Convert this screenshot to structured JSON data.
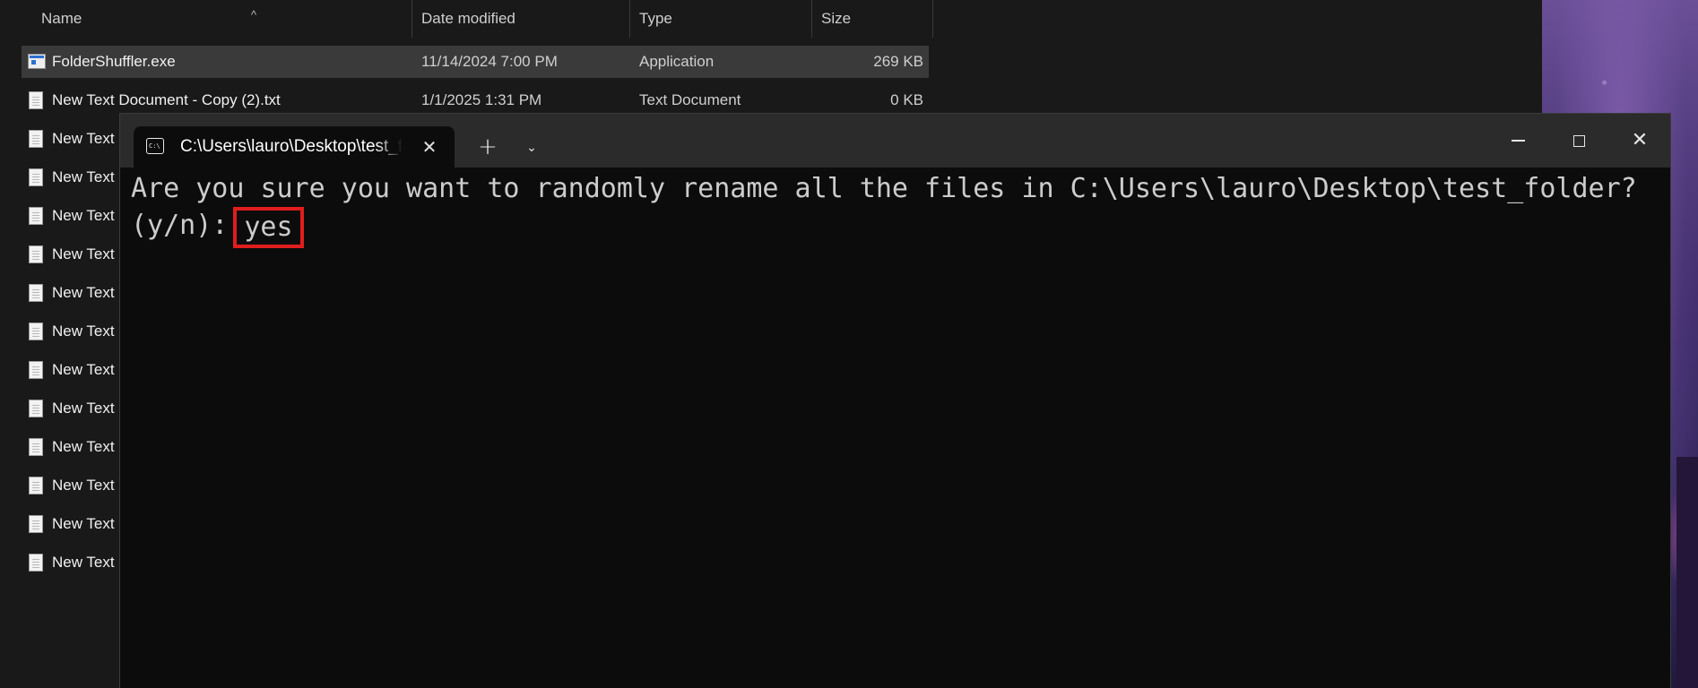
{
  "explorer": {
    "columns": {
      "name": "Name",
      "date_modified": "Date modified",
      "type": "Type",
      "size": "Size"
    },
    "files": [
      {
        "name": "FolderShuffler.exe",
        "date": "11/14/2024 7:00 PM",
        "type": "Application",
        "size": "269 KB",
        "icon": "exe-icon",
        "selected": true
      },
      {
        "name": "New Text Document - Copy (2).txt",
        "date": "1/1/2025 1:31 PM",
        "type": "Text Document",
        "size": "0 KB",
        "icon": "text-file-icon"
      },
      {
        "name": "New Text",
        "icon": "text-file-icon"
      },
      {
        "name": "New Text",
        "icon": "text-file-icon"
      },
      {
        "name": "New Text",
        "icon": "text-file-icon"
      },
      {
        "name": "New Text",
        "icon": "text-file-icon"
      },
      {
        "name": "New Text",
        "icon": "text-file-icon"
      },
      {
        "name": "New Text",
        "icon": "text-file-icon"
      },
      {
        "name": "New Text",
        "icon": "text-file-icon"
      },
      {
        "name": "New Text",
        "icon": "text-file-icon"
      },
      {
        "name": "New Text",
        "icon": "text-file-icon"
      },
      {
        "name": "New Text",
        "icon": "text-file-icon"
      },
      {
        "name": "New Text",
        "icon": "text-file-icon"
      },
      {
        "name": "New Text",
        "icon": "text-file-icon"
      }
    ]
  },
  "terminal": {
    "tab_title": "C:\\Users\\lauro\\Desktop\\test_folder",
    "cmd_icon_text": "C:\\",
    "new_tab_glyph": "+",
    "tab_menu_glyph": "⌄",
    "close_glyph": "✕",
    "prompt_line_1": "Are you sure you want to randomly rename all the files in C:\\Users\\lauro\\Desktop\\test_folder?",
    "prompt_line_2": "(y/n):",
    "user_input": "yes",
    "highlight_color": "#e01d1d"
  }
}
